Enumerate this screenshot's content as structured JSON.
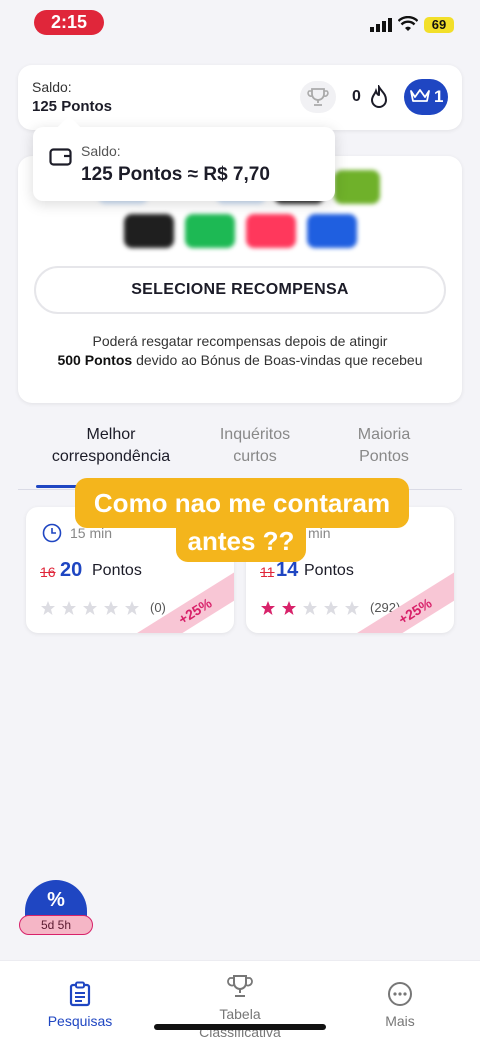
{
  "status_bar": {
    "time": "2:15",
    "battery": "69"
  },
  "balance": {
    "label": "Saldo:",
    "value": "125 Pontos",
    "streak_count": "0",
    "level": "1"
  },
  "tooltip": {
    "label": "Saldo:",
    "value": "125 Pontos ≈ R$ 7,70"
  },
  "rewards": {
    "select_button": "SELECIONE RECOMPENSA",
    "note_before": "Poderá resgatar recompensas depois de atingir",
    "note_bold": "500 Pontos",
    "note_after": "devido ao Bónus de Boas-vindas  que recebeu",
    "logos": [
      "amazon",
      "spotify",
      "airbnb",
      "ebay"
    ],
    "logo_colors": {
      "amazon": "#1f1f1f",
      "spotify": "#1db954",
      "airbnb": "#ff385c",
      "ebay": "#1f5fe0"
    }
  },
  "tabs": [
    {
      "label": "Melhor correspondência",
      "active": true
    },
    {
      "label": "Inquéritos curtos",
      "active": false
    },
    {
      "label": "Maioria Pontos",
      "active": false
    }
  ],
  "surveys": [
    {
      "duration": "15 min",
      "old_points": "16",
      "new_points": "20",
      "points_word": "Pontos",
      "stars_filled": 0,
      "rating_count": "(0)",
      "bonus": "+25%"
    },
    {
      "duration": "min",
      "old_points": "11",
      "new_points": "14",
      "points_word": "Pontos",
      "stars_filled": 2,
      "rating_count": "(292)",
      "bonus": "+25%"
    }
  ],
  "caption": {
    "line1": "Como nao me contaram",
    "line2": "antes ??"
  },
  "promo": {
    "icon": "%",
    "timer": "5d 5h"
  },
  "nav": [
    {
      "label": "Pesquisas",
      "icon": "clipboard-icon",
      "active": true
    },
    {
      "label": "Tabela Classificativa",
      "icon": "trophy-icon",
      "active": false
    },
    {
      "label": "Mais",
      "icon": "more-icon",
      "active": false
    }
  ],
  "colors": {
    "accent": "#1f46c2",
    "danger": "#e0263a",
    "caption": "#f4b51c",
    "star_active": "#d8226a"
  }
}
